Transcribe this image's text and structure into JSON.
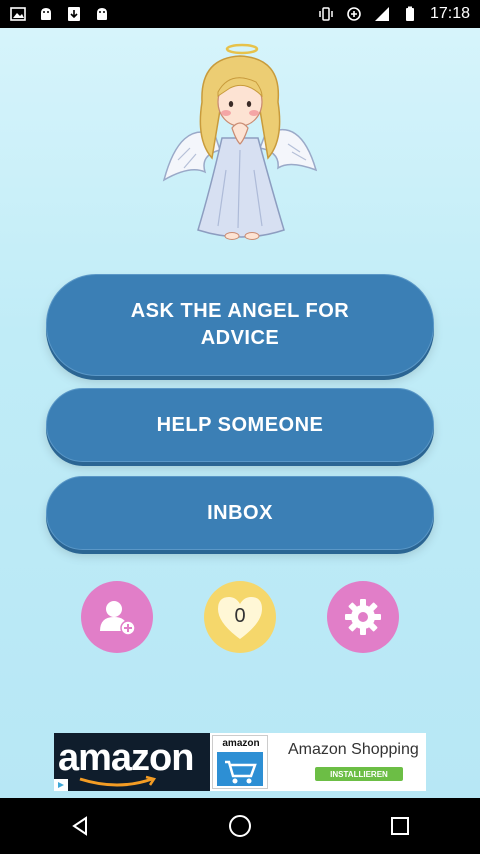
{
  "status_bar": {
    "time": "17:18",
    "left_icons": [
      "image-icon",
      "android-icon",
      "download-icon",
      "android-icon"
    ],
    "right_icons": [
      "vibrate-icon",
      "data-saver-icon",
      "signal-icon",
      "battery-icon"
    ]
  },
  "app": {
    "buttons": {
      "ask": "ASK THE ANGEL FOR ADVICE",
      "help": "HELP SOMEONE",
      "inbox": "INBOX"
    },
    "round_buttons": {
      "add_friend_icon": "add-user-icon",
      "heart_count": "0",
      "settings_icon": "gear-icon"
    },
    "colors": {
      "button_blue": "#3b7fb5",
      "pink": "#e17ec8",
      "yellow": "#f5d76b",
      "background": "#c0ecf7"
    }
  },
  "ad": {
    "brand": "amazon",
    "cart_label": "amazon",
    "title": "Amazon Shopping",
    "install_label": "INSTALLIEREN"
  },
  "nav_bar": {
    "icons": [
      "back-icon",
      "home-icon",
      "recents-icon"
    ]
  }
}
